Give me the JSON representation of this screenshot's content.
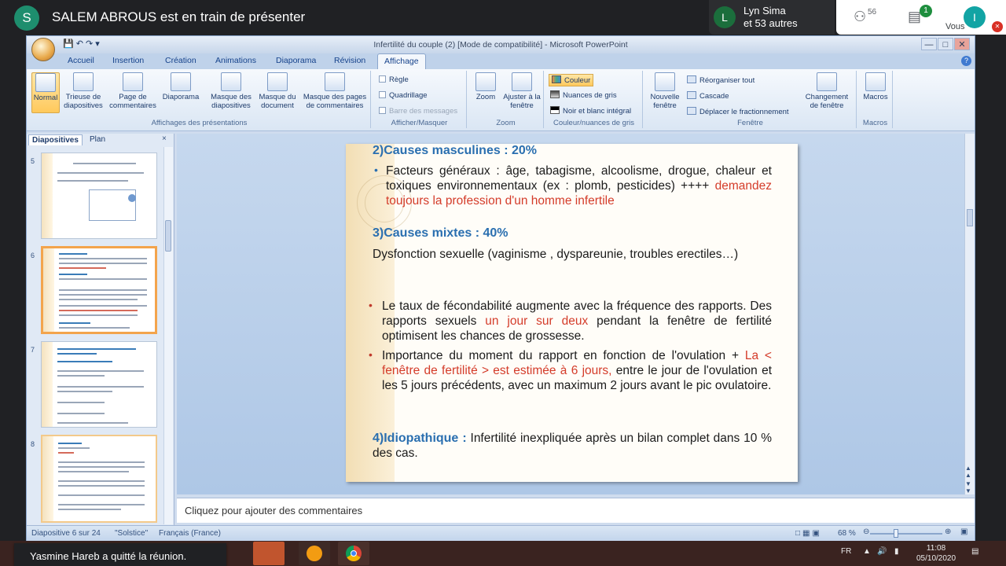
{
  "meet": {
    "presenter_initial": "S",
    "presenter_text": "SALEM ABROUS est en train de présenter",
    "participant_initial": "L",
    "participant_name": "Lyn Sima",
    "participant_others": "et 53 autres",
    "people_count": "56",
    "chat_badge": "1",
    "self_initial": "I",
    "self_label": "Vous",
    "toast": "Yasmine Hareb a quitté la réunion."
  },
  "window": {
    "title": "Infertilité du couple (2) [Mode de compatibilité] - Microsoft PowerPoint"
  },
  "tabs": [
    "Accueil",
    "Insertion",
    "Création",
    "Animations",
    "Diaporama",
    "Révision",
    "Affichage"
  ],
  "active_tab": "Affichage",
  "ribbon": {
    "groups": {
      "presentation_views": "Affichages des présentations",
      "show_hide": "Afficher/Masquer",
      "zoom": "Zoom",
      "color": "Couleur/nuances de gris",
      "window": "Fenêtre",
      "macros": "Macros"
    },
    "buttons": {
      "normal": "Normal",
      "sorter": "Trieuse de diapositives",
      "notes_page": "Page de commentaires",
      "slideshow": "Diaporama",
      "slide_master": "Masque des diapositives",
      "handout_master": "Masque du document",
      "notes_master": "Masque des pages de commentaires",
      "zoom": "Zoom",
      "fit_window": "Ajuster à la fenêtre",
      "new_window": "Nouvelle fenêtre",
      "switch_window": "Changement de fenêtre",
      "macros": "Macros"
    },
    "checks": {
      "ruler": "Règle",
      "grid": "Quadrillage",
      "message_bar": "Barre des messages"
    },
    "color_opts": {
      "color": "Couleur",
      "grayscale": "Nuances de gris",
      "bw": "Noir et blanc intégral"
    },
    "window_opts": {
      "arrange": "Réorganiser tout",
      "cascade": "Cascade",
      "split": "Déplacer le fractionnement"
    }
  },
  "slides_panel": {
    "tab_slides": "Diapositives",
    "tab_outline": "Plan",
    "close": "×",
    "numbers": [
      "5",
      "6",
      "7",
      "8"
    ]
  },
  "slide": {
    "h2": "2)Causes masculines : 20%",
    "b1_text": "Facteurs généraux : âge, tabagisme, alcoolisme, drogue, chaleur et toxiques environnementaux (ex : plomb, pesticides) ++++ ",
    "b1_red": "demandez toujours la profession d'un homme infertile",
    "h3": "3)Causes mixtes : 40%",
    "mixtes": "Dysfonction sexuelle (vaginisme , dyspareunie, troubles erectiles…)",
    "b2_a": "Le taux de fécondabilité augmente avec la fréquence des rapports. Des rapports sexuels ",
    "b2_red": "un jour sur deux",
    "b2_b": " pendant la fenêtre de fertilité optimisent les chances de grossesse.",
    "b3_a": "Importance du moment du rapport en fonction de l'ovulation + ",
    "b3_red": "La        < fenêtre de fertilité > est estimée à 6 jours,",
    "b3_b": " entre le jour de l'ovulation et les 5 jours précédents, avec un maximum 2 jours avant le pic ovulatoire.",
    "h4": "4)Idiopathique :",
    "idio": " Infertilité inexpliquée après un bilan complet dans 10 % des cas."
  },
  "notes_placeholder": "Cliquez pour ajouter des commentaires",
  "status": {
    "slide_count": "Diapositive 6 sur 24",
    "theme": "\"Solstice\"",
    "language": "Français (France)",
    "zoom": "68 %"
  },
  "taskbar": {
    "lang": "FR",
    "time": "11:08",
    "date": "05/10/2020"
  }
}
